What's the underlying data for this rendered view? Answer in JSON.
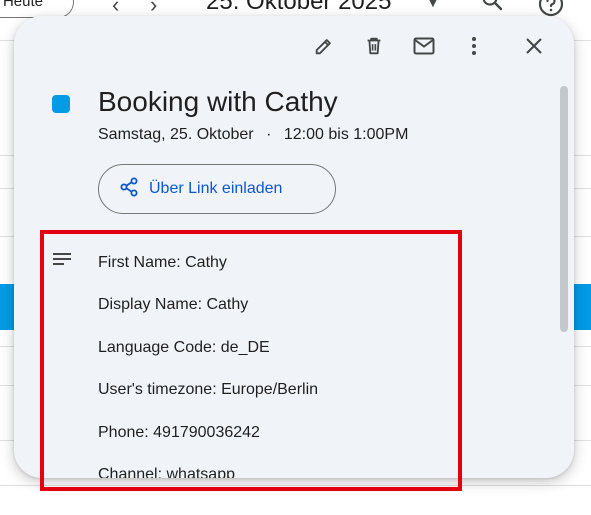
{
  "calendar_header": {
    "today_label": "Heute",
    "date_title": "25. Oktober 2025"
  },
  "event": {
    "title": "Booking with Cathy",
    "date": "Samstag, 25. Oktober",
    "separator": "·",
    "time": "12:00 bis 1:00PM",
    "color": "#039be5",
    "invite_button_label": "Über Link einladen",
    "description": [
      "First Name: Cathy",
      "Display Name: Cathy",
      "Language Code: de_DE",
      "User's timezone: Europe/Berlin",
      "Phone: 491790036242",
      "Channel: whatsapp"
    ]
  },
  "toolbar": {
    "icons": [
      "edit-icon",
      "delete-icon",
      "email-icon",
      "more-options-icon",
      "close-icon"
    ]
  },
  "colors": {
    "accent": "#039be5",
    "link": "#0b57d0",
    "highlight_border": "#e3000f",
    "card_background": "#f0f4f9"
  }
}
